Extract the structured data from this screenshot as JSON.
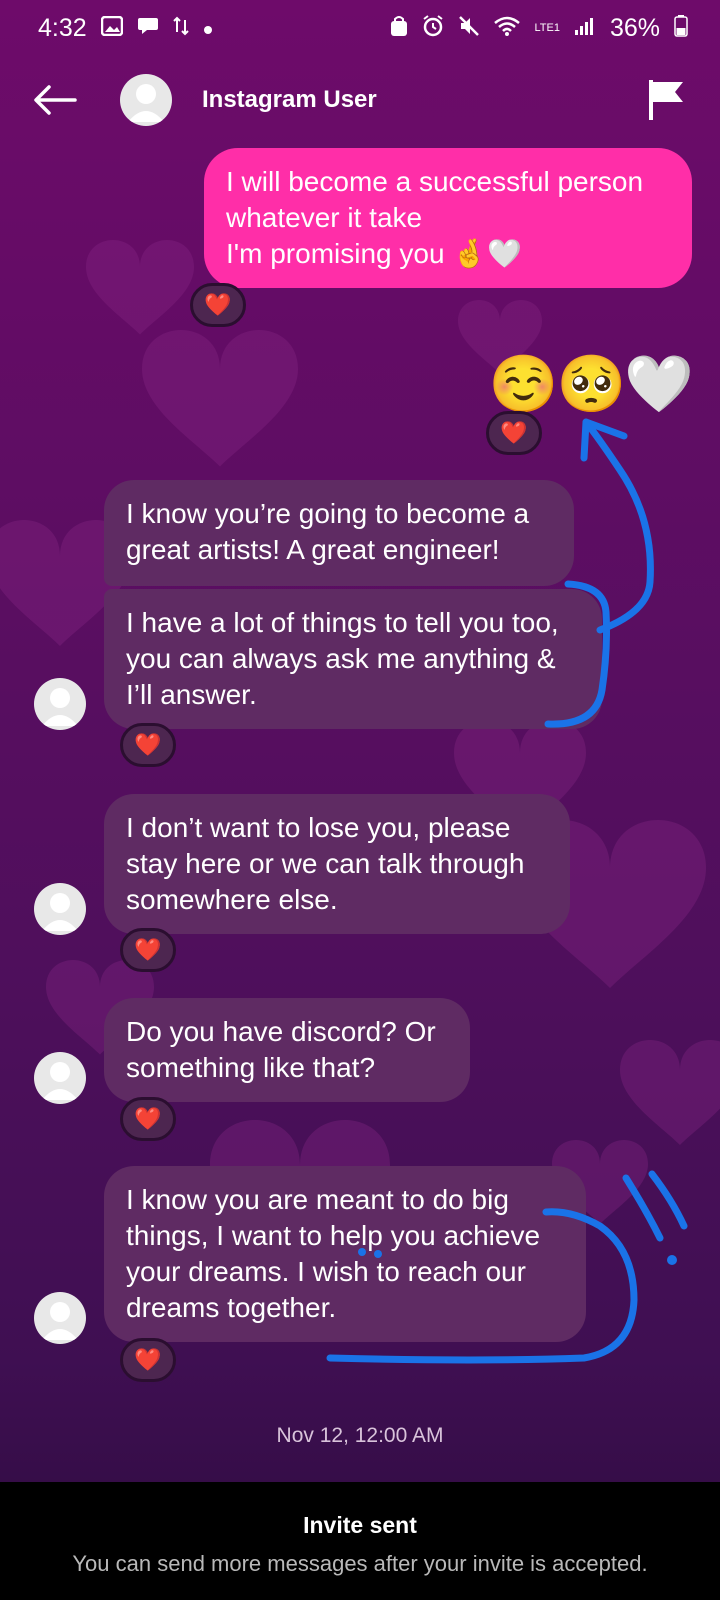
{
  "status_bar": {
    "time": "4:32",
    "network": "LTE1",
    "battery": "36%",
    "left_icons": [
      "gallery-icon",
      "chat-icon",
      "data-transfer-icon",
      "dot-icon"
    ],
    "right_icons": [
      "vpn-icon",
      "alarm-icon",
      "mute-icon",
      "wifi-icon",
      "signal-icon",
      "battery-icon"
    ]
  },
  "header": {
    "title": "Instagram User"
  },
  "messages": [
    {
      "type": "sent",
      "text": "I will become a successful person\nwhatever it take\nI'm promising you 🤞🤍",
      "reaction": "❤️"
    },
    {
      "type": "sent",
      "text": "☺️🥺🤍",
      "reaction": "❤️"
    },
    {
      "type": "received",
      "text": "I know you’re going to become a\ngreat artists! A great engineer!"
    },
    {
      "type": "received",
      "text": "I have a lot of things to tell you too,\nyou can always ask me anything &\nI’ll answer.",
      "reaction": "❤️"
    },
    {
      "type": "received",
      "text": "I don’t want to lose you, please\nstay here or we can talk through\nsomewhere else.",
      "reaction": "❤️"
    },
    {
      "type": "received",
      "text": "Do you have discord? Or\nsomething like that?",
      "reaction": "❤️"
    },
    {
      "type": "received",
      "text": "I know you are meant to do big\nthings, I want to help you achieve\nyour dreams. I wish to reach our\ndreams together.",
      "reaction": "❤️"
    }
  ],
  "timestamp": "Nov 12, 12:00 AM",
  "footer": {
    "title": "Invite sent",
    "subtitle": "You can send more messages after your invite is accepted."
  },
  "colors": {
    "sent_bubble": "#ff2ea8",
    "received_bubble": "#5f2b63",
    "annotation": "#1a73e8"
  }
}
